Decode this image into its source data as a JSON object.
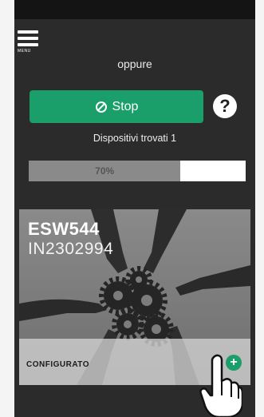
{
  "header": {
    "menu_label": "MENU"
  },
  "scan": {
    "alternative_text": "oppure",
    "stop_label": "Stop",
    "devices_found": "Dispositivi trovati 1",
    "progress_value": 0.7,
    "progress_label": "70%"
  },
  "device_card": {
    "title": "ESW544",
    "serial": "IN2302994",
    "status": "CONFIGURATO"
  },
  "icons": {
    "menu": "hamburger-icon",
    "stop": "ban-icon",
    "help": "question-icon",
    "add": "plus-circle-icon",
    "cursor": "hand-pointer-icon"
  },
  "colors": {
    "accent_green": "#1a9e6a",
    "background_dark": "#2b2b2b",
    "progress_fill": "#8a8a8a"
  }
}
